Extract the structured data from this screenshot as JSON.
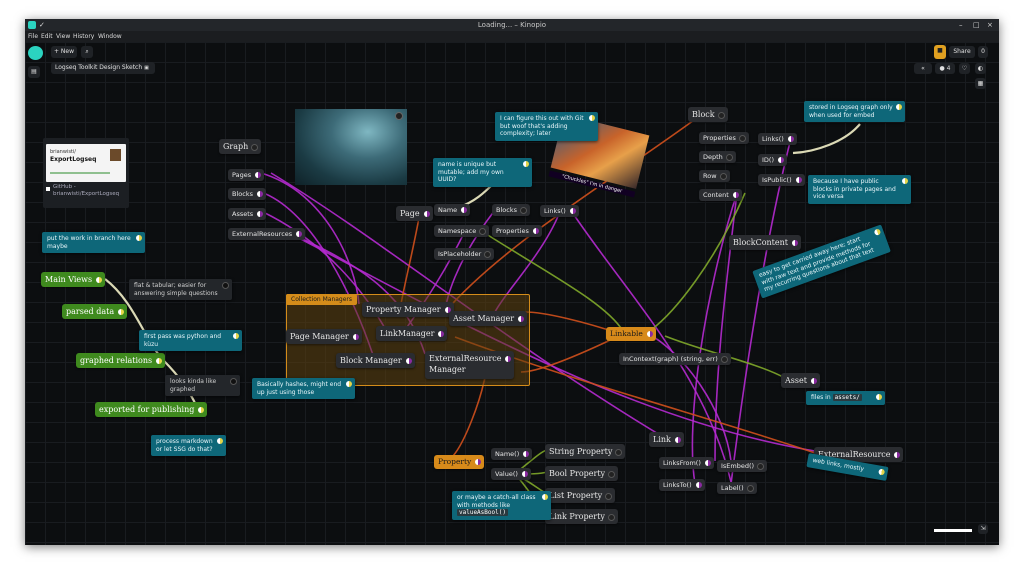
{
  "window": {
    "title": "Loading... – Kinopio",
    "minimize": "–",
    "maximize": "□",
    "close": "×"
  },
  "menu": {
    "file": "File",
    "edit": "Edit",
    "view": "View",
    "history": "History",
    "window": "Window"
  },
  "toolbar": {
    "new_label": "+ New",
    "search_icon": "⌕",
    "space_name": "Logseq Toolkit Design Sketch",
    "lock_icon": "🔒",
    "share_label": "Share",
    "share_count": "0",
    "users_count": "4",
    "brand_color": "#2bd3c0"
  },
  "nodes": {
    "graph": "Graph",
    "pages": "Pages",
    "blocks": "Blocks",
    "assets": "Assets",
    "external_resources": "ExternalResources",
    "page": "Page",
    "name": "Name",
    "namespace": "Namespace",
    "is_placeholder": "IsPlaceholder",
    "page_blocks": "Blocks",
    "page_properties": "Properties",
    "links": "Links()",
    "block": "Block",
    "block_properties": "Properties",
    "depth": "Depth",
    "row": "Row",
    "content": "Content",
    "block_links": "Links()",
    "id": "ID()",
    "is_public": "IsPublic()",
    "block_content": "BlockContent",
    "property_manager": "Property Manager",
    "asset_manager": "Asset Manager",
    "page_manager": "Page Manager",
    "link_manager": "LinkManager",
    "block_manager": "Block Manager",
    "external_resource_manager_1": "ExternalResource",
    "external_resource_manager_2": "Manager",
    "linkable": "Linkable",
    "in_context": "InContext(graph) (string, err)",
    "asset": "Asset",
    "link": "Link",
    "links_from": "LinksFrom()",
    "links_to": "LinksTo()",
    "is_embed": "IsEmbed()",
    "label": "Label()",
    "external_resource": "ExternalResource",
    "property": "Property",
    "prop_name": "Name()",
    "prop_value": "Value()",
    "string_property": "String Property",
    "bool_property": "Bool Property",
    "list_property": "List Property",
    "link_property": "Link Property",
    "main_views": "Main Views",
    "parsed_data": "parsed data",
    "graphed_relations": "graphed relations",
    "exported_for_publishing": "exported for publishing"
  },
  "group_title": "Collection Managers",
  "notes": {
    "put_work": "put the work in branch here maybe",
    "flat_tabular": "flat & tabular; easier for answering simple questions",
    "first_pass": "first pass was python and kùzu",
    "looks_kinda": "looks kinda like graphed",
    "basically_hashes": "Basically hashes, might end up just using those",
    "process_markdown": "process markdown or let SSG do that?",
    "name_unique": "name is unique but mutable; add my own UUID?",
    "figure_out": "I can figure this out with Git but woof that's adding complexity; later",
    "stored_logseq": "stored in Logseq graph only when used for embed",
    "public_blocks": "Because I have public blocks in private pages and vice versa",
    "easy_carried": "easy to get carried away here; start with raw text and provide methods for my recurring questions about that text",
    "files_in": "files in",
    "files_in_code": "assets/",
    "web_links": "web links, mostly",
    "catch_all": "or maybe a catch-all class with methods like",
    "catch_all_code": "valueAsBool()"
  },
  "embeds": {
    "repo_title_1": "brianwisti/",
    "repo_title_2": "ExportLogseq",
    "repo_link": "GitHub - brianwisti/ExportLogseq",
    "chuckles_caption": "\"Chuckles\" I'm in danger"
  },
  "colors": {
    "wire_purple": "#b52ad0",
    "wire_orange": "#d0501c",
    "wire_green": "#7fa82a",
    "wire_white": "#f2f0c8"
  }
}
